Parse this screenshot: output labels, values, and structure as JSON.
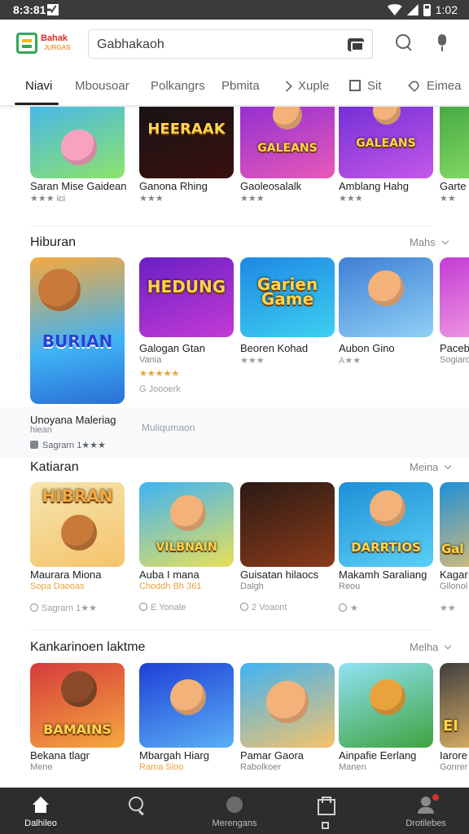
{
  "status_bar": {
    "time": "8:3:81",
    "right_time": "1:02"
  },
  "header": {
    "logo_text": "Bahak",
    "logo_sub": "JURGAS",
    "search_value": "Gabhakaoh"
  },
  "tabs": [
    {
      "label": "Niavi"
    },
    {
      "label": "Mbousoar"
    },
    {
      "label": "Polkangrs"
    },
    {
      "label": "Pbmita"
    },
    {
      "label": "Xuple"
    },
    {
      "label": "Sit"
    },
    {
      "label": "Eimea"
    }
  ],
  "row1": {
    "apps": [
      {
        "name": "Saran Mise Gaidean",
        "rating": "★★★ ici",
        "thumb_text": "",
        "colors": [
          "#3fb3f5",
          "#8de36a"
        ]
      },
      {
        "name": "Ganona Rhing",
        "rating": "★★★",
        "thumb_text": "HEERAAK",
        "colors": [
          "#141414",
          "#3a1010"
        ]
      },
      {
        "name": "Gaoleosalalk",
        "rating": "★★★",
        "thumb_text": "GALEANS",
        "colors": [
          "#8a2bd4",
          "#e85ab8"
        ]
      },
      {
        "name": "Amblang Hahg",
        "rating": "★★★",
        "thumb_text": "GALEANS",
        "colors": [
          "#6b2bd4",
          "#c458e8"
        ]
      },
      {
        "name": "Garte",
        "rating": "★★",
        "thumb_text": "",
        "colors": [
          "#3fa33f",
          "#8fe36a"
        ]
      }
    ]
  },
  "section_hiburan": {
    "title": "Hiburan",
    "more": "Mahs",
    "featured": {
      "thumb_text": "BURIAN",
      "colors": [
        "#f5a93f",
        "#3fb3f5"
      ]
    },
    "apps": [
      {
        "name": "Galogan Gtan",
        "sub": "Vania",
        "rating": "★★★★★",
        "meta": "G Joooerk",
        "thumb_text": "HEDUNG",
        "colors": [
          "#6a1fc4",
          "#c43bd6"
        ]
      },
      {
        "name": "Beoren Kohad",
        "rating": "★★★",
        "thumb_text": "Garien Game",
        "colors": [
          "#1e88e5",
          "#3dd0f0"
        ]
      },
      {
        "name": "Aubon Gino",
        "rating": "A★★",
        "thumb_text": "",
        "colors": [
          "#3f7fd6",
          "#8fd0f5"
        ]
      },
      {
        "name": "Pacebo",
        "sub": "Sogiaro",
        "thumb_text": "",
        "colors": [
          "#c43bd6",
          "#f5a9e0"
        ]
      }
    ],
    "card": {
      "title": "Unoyana Maleriag",
      "sub": "hiean",
      "meta": "Sagrarn 1★★★",
      "mid": "Muliqumaon"
    }
  },
  "section_katiaran": {
    "title": "Katiaran",
    "more": "Meina",
    "apps": [
      {
        "name": "Maurara Miona",
        "sub": "Sopa Daooas",
        "meta": "Sagrarn 1★★",
        "thumb_text": "HIBRAN",
        "colors": [
          "#f5e6b0",
          "#f5c36a"
        ]
      },
      {
        "name": "Auba I mana",
        "sub": "Choddh Bh 361",
        "meta": "E Yonale",
        "thumb_text": "VILBNAIN",
        "colors": [
          "#3fb3f5",
          "#e8e05a"
        ]
      },
      {
        "name": "Guisatan hilaocs",
        "sub": "Dalgh",
        "meta": "2 Voaont",
        "thumb_text": "",
        "colors": [
          "#2a1a14",
          "#8a3b1a"
        ]
      },
      {
        "name": "Makamh Saraliang",
        "sub": "Reou",
        "rating": "★",
        "thumb_text": "DARRTIOS",
        "colors": [
          "#1e8fd6",
          "#5ad0f5"
        ]
      },
      {
        "name": "Kagar",
        "sub": "Gllonol",
        "rating": "★★",
        "thumb_text": "Gal",
        "colors": [
          "#1e8fd6",
          "#f5c36a"
        ]
      }
    ]
  },
  "section_kankarinoen": {
    "title": "Kankarinoen laktme",
    "more": "Melha",
    "apps": [
      {
        "name": "Bekana tlagr",
        "sub": "Mene",
        "thumb_text": "BAMAINS",
        "colors": [
          "#d63b3b",
          "#f5a93f"
        ]
      },
      {
        "name": "Mbargah Hiarg",
        "sub": "Rama Sloo",
        "thumb_text": "",
        "colors": [
          "#1e3fd6",
          "#5ab0f5"
        ]
      },
      {
        "name": "Pamar Gaora",
        "sub": "Rabolkoer",
        "thumb_text": "",
        "colors": [
          "#3fb3f5",
          "#f5c36a"
        ]
      },
      {
        "name": "Ainpafie Eerlang",
        "sub": "Manen",
        "thumb_text": "",
        "colors": [
          "#3fa33f",
          "#8fe3f5"
        ]
      },
      {
        "name": "Iarore",
        "sub": "Gonrer",
        "thumb_text": "EI",
        "colors": [
          "#3f3f3f",
          "#f5c36a"
        ]
      }
    ]
  },
  "bottom_nav": [
    {
      "label": "Dalhileo"
    },
    {
      "label": ""
    },
    {
      "label": "Merengans"
    },
    {
      "label": ""
    },
    {
      "label": "Drotilebes"
    }
  ]
}
